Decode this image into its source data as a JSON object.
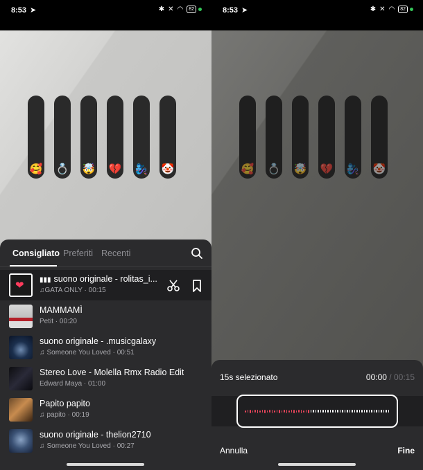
{
  "status_bar": {
    "time": "8:53",
    "battery": "82"
  },
  "sliders": [
    {
      "emoji": "🥰"
    },
    {
      "emoji": "💍"
    },
    {
      "emoji": "🤯"
    },
    {
      "emoji": "💔"
    },
    {
      "emoji": "🧞‍♀️"
    },
    {
      "emoji": "🤡"
    }
  ],
  "music_panel": {
    "tabs": [
      "Consigliato",
      "Preferiti",
      "Recenti"
    ],
    "active_tab": "Consigliato",
    "selected_song": {
      "title": "suono originale - rolitas_i...",
      "subtitle": "GATA ONLY · 00:15"
    },
    "songs": [
      {
        "title": "MAMMAMÌ",
        "subtitle": "Petit · 00:20"
      },
      {
        "title": "suono originale - .musicgalaxy",
        "subtitle": "Someone You Loved · 00:51"
      },
      {
        "title": "Stereo Love - Molella Rmx Radio Edit",
        "subtitle": "Edward Maya · 01:00"
      },
      {
        "title": "Papito papito",
        "subtitle": "papito · 00:19"
      },
      {
        "title": "suono originale - thelion2710",
        "subtitle": "Someone You Loved · 00:27"
      }
    ]
  },
  "trim_panel": {
    "title": "15s selezionato",
    "current_time": "00:00",
    "separator": "/",
    "total_time": "00:15",
    "cancel_label": "Annulla",
    "done_label": "Fine",
    "progress": 0.45,
    "colors": {
      "played": "#e8455b",
      "remaining": "#ffffff"
    }
  }
}
